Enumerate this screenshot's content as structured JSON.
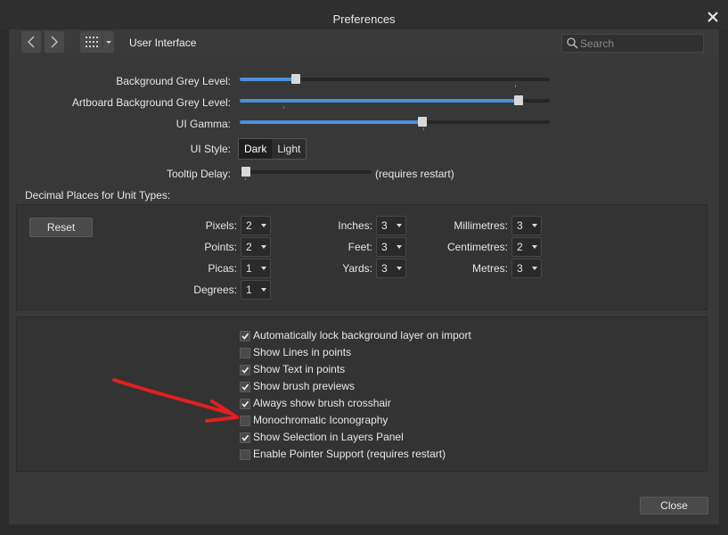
{
  "window": {
    "title": "Preferences"
  },
  "toolbar": {
    "breadcrumb": "User Interface",
    "search_placeholder": "Search"
  },
  "sliders": [
    {
      "label": "Background Grey Level:",
      "value": 0.18
    },
    {
      "label": "Artboard Background Grey Level:",
      "value": 0.9
    },
    {
      "label": "UI Gamma:",
      "value": 0.59
    }
  ],
  "ui_style": {
    "label": "UI Style:",
    "options": [
      "Dark",
      "Light"
    ],
    "selected": "Dark"
  },
  "tooltip": {
    "label": "Tooltip Delay:",
    "value": 0.0,
    "note": "(requires restart)"
  },
  "decimal": {
    "title": "Decimal Places for Unit Types:",
    "reset": "Reset",
    "units": [
      {
        "label": "Pixels:",
        "value": "2"
      },
      {
        "label": "Points:",
        "value": "2"
      },
      {
        "label": "Picas:",
        "value": "1"
      },
      {
        "label": "Degrees:",
        "value": "1"
      },
      {
        "label": "Inches:",
        "value": "3"
      },
      {
        "label": "Feet:",
        "value": "3"
      },
      {
        "label": "Yards:",
        "value": "3"
      },
      {
        "label": "Millimetres:",
        "value": "3"
      },
      {
        "label": "Centimetres:",
        "value": "2"
      },
      {
        "label": "Metres:",
        "value": "3"
      }
    ]
  },
  "options": [
    {
      "label": "Automatically lock background layer on import",
      "checked": true
    },
    {
      "label": "Show Lines in points",
      "checked": false
    },
    {
      "label": "Show Text in points",
      "checked": true
    },
    {
      "label": "Show brush previews",
      "checked": true
    },
    {
      "label": "Always show brush crosshair",
      "checked": true
    },
    {
      "label": "Monochromatic Iconography",
      "checked": false
    },
    {
      "label": "Show Selection in Layers Panel",
      "checked": true
    },
    {
      "label": "Enable Pointer Support (requires restart)",
      "checked": false
    }
  ],
  "footer": {
    "close": "Close"
  },
  "colors": {
    "accent": "#4a90d9",
    "annotation": "#e0201f"
  }
}
